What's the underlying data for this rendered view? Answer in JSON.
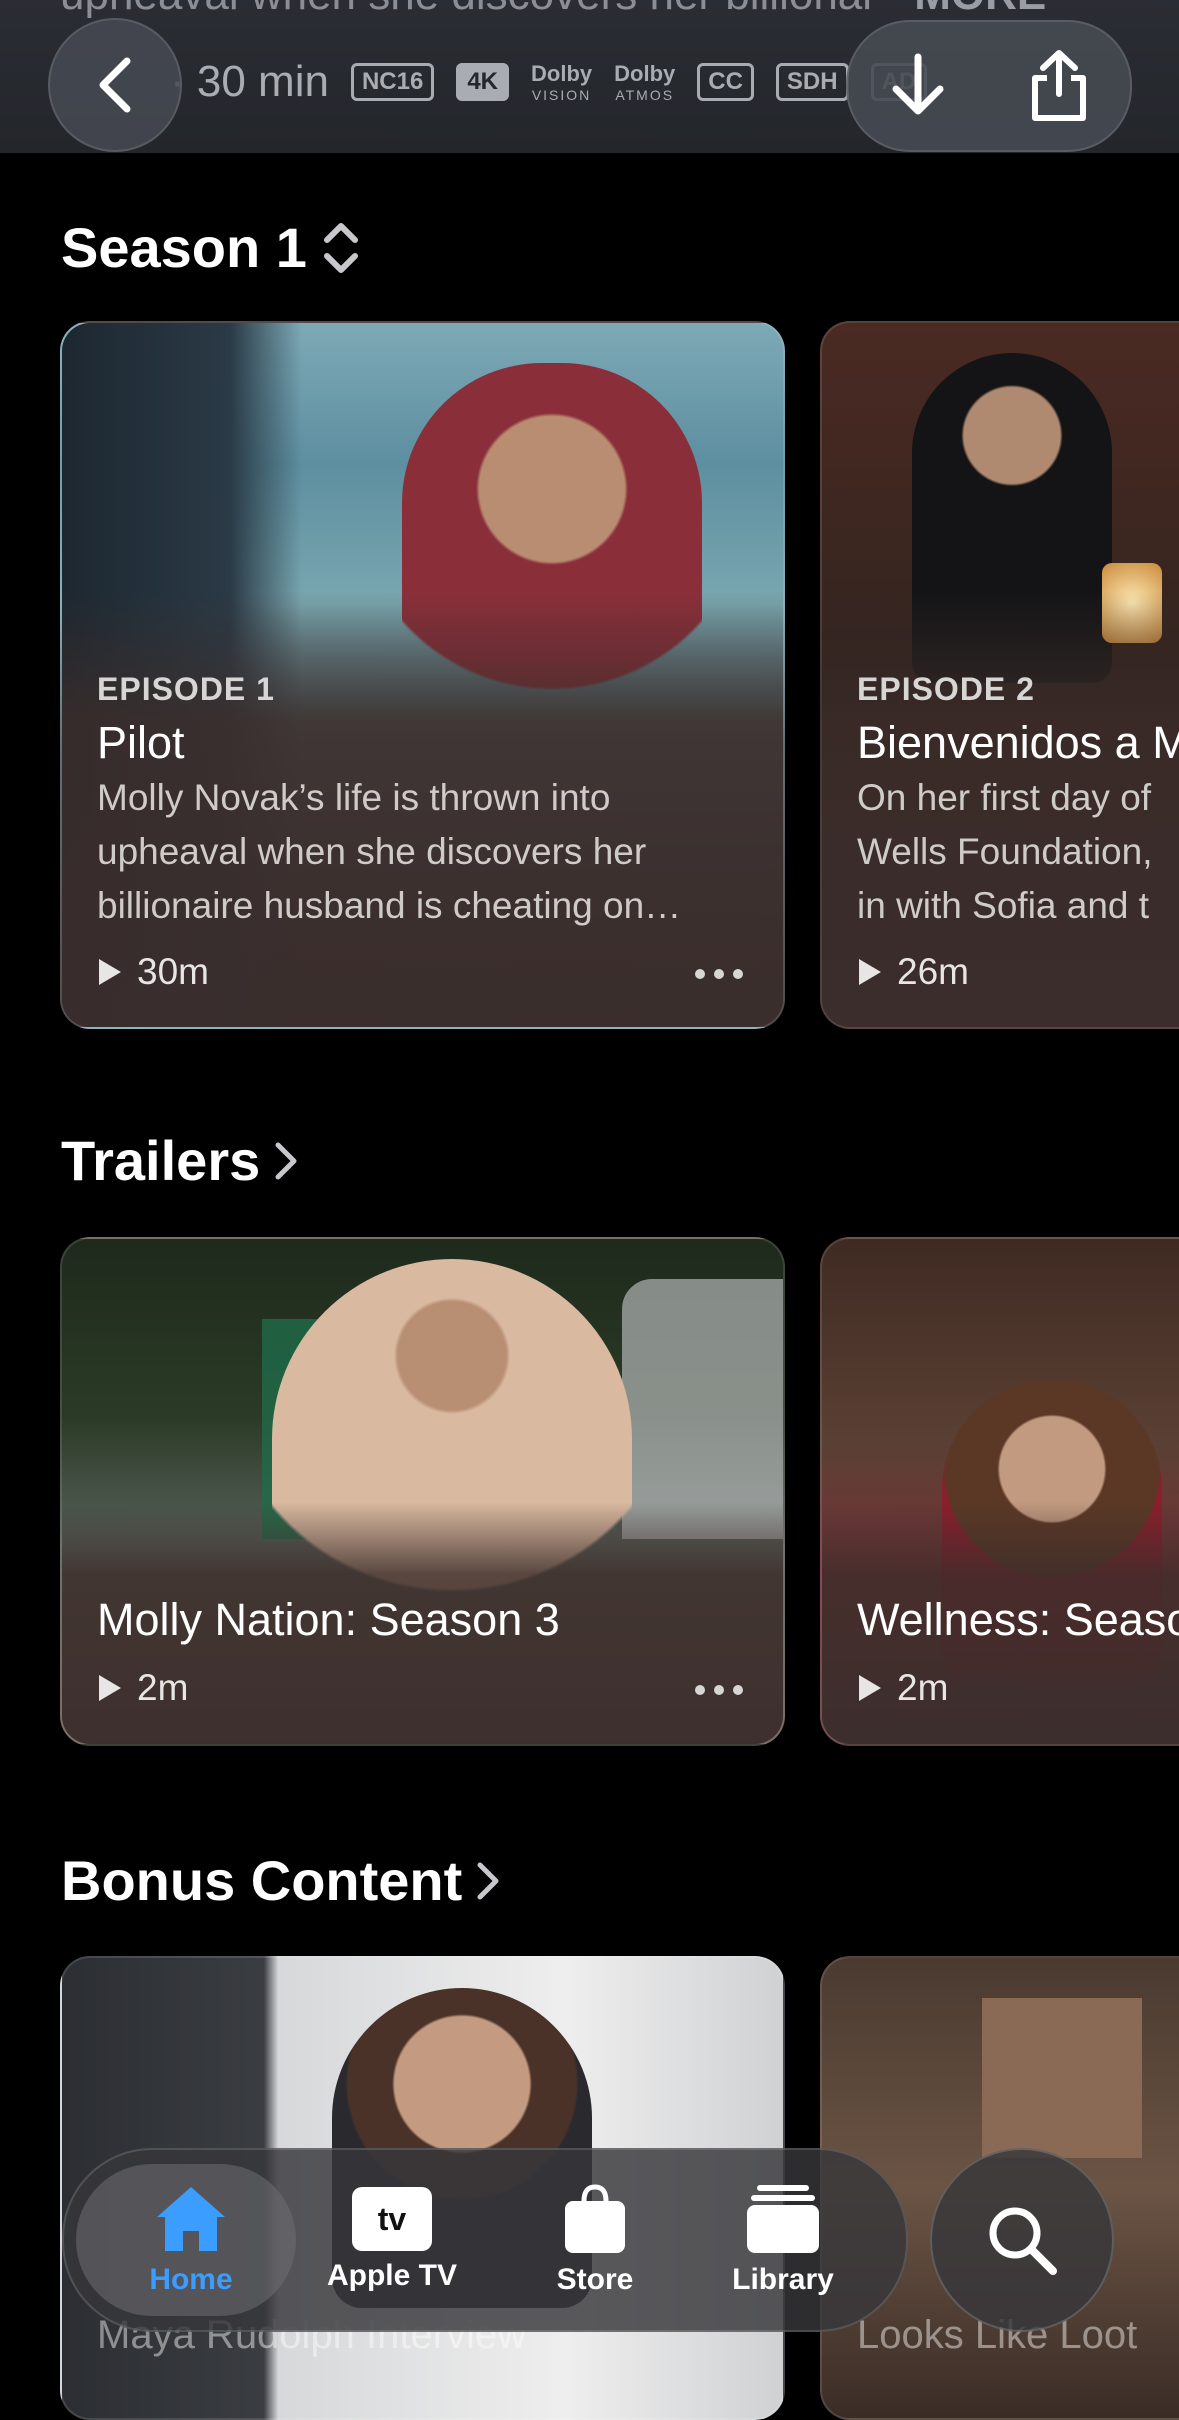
{
  "header": {
    "cut_text": "upheaval when she discovers her billionai",
    "cut_more": "MORE",
    "runtime": "· 30 min",
    "badges": [
      "NC16",
      "4K",
      "CC",
      "SDH",
      "AD"
    ],
    "dolby_vision": {
      "top": "Dolby",
      "bottom": "VISION"
    },
    "dolby_atmos": {
      "top": "Dolby",
      "bottom": "ATMOS"
    }
  },
  "season": {
    "heading": "Season 1",
    "episodes": [
      {
        "label": "EPISODE 1",
        "title": "Pilot",
        "description_lines": [
          "Molly Novak’s life is thrown into",
          "upheaval when she discovers her",
          "billionaire husband is cheating on…"
        ],
        "duration": "30m"
      },
      {
        "label": "EPISODE 2",
        "title": "Bienvenidos a M",
        "description_lines": [
          "On her first day of",
          "Wells Foundation,",
          "in with Sofia and t"
        ],
        "duration": "26m"
      }
    ]
  },
  "trailers": {
    "heading": "Trailers",
    "items": [
      {
        "title": "Molly Nation: Season 3",
        "duration": "2m"
      },
      {
        "title": "Wellness: Seaso",
        "duration": "2m"
      }
    ]
  },
  "bonus": {
    "heading": "Bonus Content",
    "items": [
      {
        "title": "Maya Rudolph Interview"
      },
      {
        "title": "Looks Like Loot"
      }
    ]
  },
  "tabbar": {
    "tabs": [
      {
        "label": "Home",
        "icon": "house-icon",
        "active": true
      },
      {
        "label": "Apple TV",
        "icon": "apple-tv-icon",
        "badge_text": "tv"
      },
      {
        "label": "Store",
        "icon": "bag-icon"
      },
      {
        "label": "Library",
        "icon": "stack-icon"
      }
    ],
    "search_icon": "magnifier-icon"
  },
  "colors": {
    "accent": "#3b9dff",
    "background": "#000000",
    "card_shade": "#3a2d2c"
  }
}
